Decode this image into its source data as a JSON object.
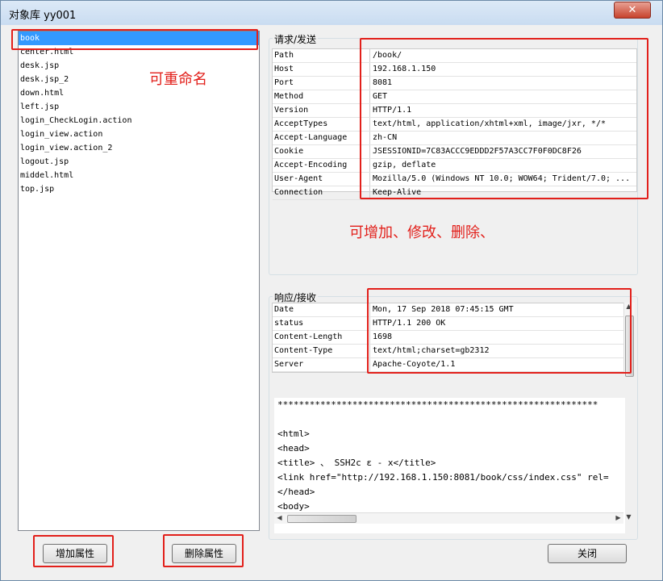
{
  "window": {
    "title": "对象库  yy001",
    "close_glyph": "✕"
  },
  "object_list": [
    "book",
    "center.html",
    "desk.jsp",
    "desk.jsp_2",
    "down.html",
    "left.jsp",
    "login_CheckLogin.action",
    "login_view.action",
    "login_view.action_2",
    "logout.jsp",
    "middel.html",
    "top.jsp"
  ],
  "request": {
    "title": "请求/发送",
    "rows": [
      {
        "k": "Path",
        "v": "/book/"
      },
      {
        "k": "Host",
        "v": "192.168.1.150"
      },
      {
        "k": "Port",
        "v": "8081"
      },
      {
        "k": "Method",
        "v": "GET"
      },
      {
        "k": "Version",
        "v": "HTTP/1.1"
      },
      {
        "k": "AcceptTypes",
        "v": " text/html, application/xhtml+xml, image/jxr, */*"
      },
      {
        "k": "Accept-Language",
        "v": " zh-CN"
      },
      {
        "k": "Cookie",
        "v": " JSESSIONID=7C83ACCC9EDDD2F57A3CC7F0F0DC8F26"
      },
      {
        "k": "Accept-Encoding",
        "v": " gzip, deflate"
      },
      {
        "k": "User-Agent",
        "v": " Mozilla/5.0 (Windows NT 10.0; WOW64; Trident/7.0; ..."
      },
      {
        "k": "Connection",
        "v": " Keep-Alive"
      }
    ]
  },
  "response": {
    "title": "响应/接收",
    "rows": [
      {
        "k": "Date",
        "v": " Mon, 17 Sep 2018 07:45:15 GMT"
      },
      {
        "k": "status",
        "v": "HTTP/1.1 200 OK"
      },
      {
        "k": "Content-Length",
        "v": " 1698"
      },
      {
        "k": "Content-Type",
        "v": " text/html;charset=gb2312"
      },
      {
        "k": "Server",
        "v": " Apache-Coyote/1.1"
      }
    ],
    "body_lines": [
      "************************************************************",
      "",
      "<html>",
      "<head>",
      "<title>        、      SSH2c         ε       -    x</title>",
      "<link href=\"http://192.168.1.150:8081/book/css/index.css\" rel=",
      " </head>",
      "<body>"
    ]
  },
  "buttons": {
    "add_attr": "增加属性",
    "del_attr": "删除属性",
    "close": "关闭"
  },
  "annotations": {
    "rename": "可重命名",
    "edit": "可增加、修改、删除、"
  },
  "colors": {
    "selection": "#3399ff",
    "annotation": "#e2201b"
  }
}
